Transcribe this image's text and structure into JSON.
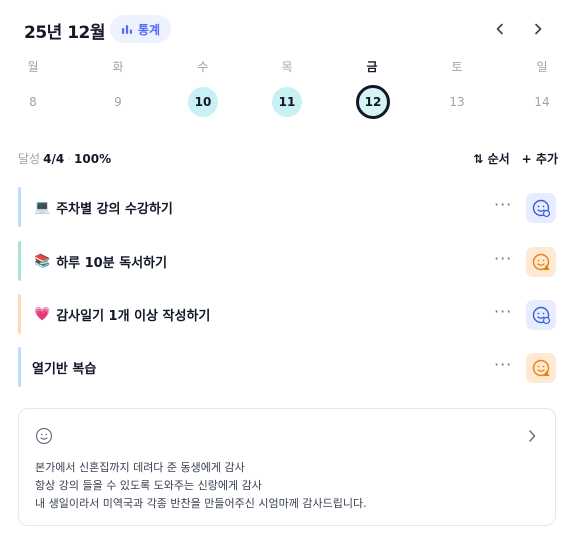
{
  "header": {
    "month": "25년 12월",
    "stats_label": "통계"
  },
  "week": {
    "days": [
      "월",
      "화",
      "수",
      "목",
      "금",
      "토",
      "일"
    ],
    "dates": [
      "8",
      "9",
      "10",
      "11",
      "12",
      "13",
      "14"
    ],
    "completed": [
      "10",
      "11"
    ],
    "today": "12"
  },
  "summary": {
    "label": "달성",
    "count": "4/4",
    "percent": "100%"
  },
  "toolbar": {
    "order_label": "순서",
    "add_label": "추가"
  },
  "habits": [
    {
      "emoji": "💻",
      "title": "주차별 강의 수강하기",
      "bar_color": "#bfdbfe",
      "face": "blue"
    },
    {
      "emoji": "📚",
      "title": "하루 10분 독서하기",
      "bar_color": "#a7e3d8",
      "face": "orange"
    },
    {
      "emoji": "💗",
      "title": "감사일기 1개 이상 작성하기",
      "bar_color": "#fcd9b6",
      "face": "blue"
    },
    {
      "emoji": "",
      "title": "열기반 복습",
      "bar_color": "#bfdbfe",
      "face": "orange"
    }
  ],
  "gratitude": {
    "lines": [
      "본가에서 신혼집까지 데려다 준 동생에게 감사",
      "항상 강의 들을 수 있도록 도와주는 신랑에게 감사",
      "내 생일이라서 미역국과 각종 반찬을 만들어주신 시엄마께 감사드립니다."
    ]
  }
}
